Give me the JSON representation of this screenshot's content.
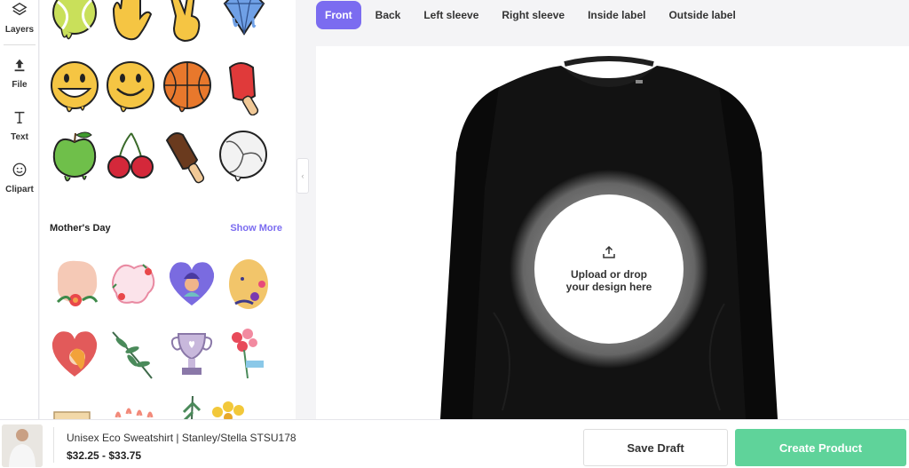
{
  "rail": {
    "items": [
      {
        "label": "Layers",
        "icon": "layers-icon"
      },
      {
        "label": "File",
        "icon": "upload-icon"
      },
      {
        "label": "Text",
        "icon": "text-icon"
      },
      {
        "label": "Clipart",
        "icon": "smiley-icon"
      }
    ]
  },
  "clipart": {
    "section_title": "Mother's Day",
    "show_more": "Show More"
  },
  "tabs": [
    {
      "label": "Front",
      "active": true
    },
    {
      "label": "Back"
    },
    {
      "label": "Left sleeve"
    },
    {
      "label": "Right sleeve"
    },
    {
      "label": "Inside label"
    },
    {
      "label": "Outside label"
    }
  ],
  "canvas": {
    "upload_line1": "Upload or drop",
    "upload_line2": "your design here"
  },
  "product": {
    "name": "Unisex Eco Sweatshirt | Stanley/Stella STSU178",
    "price": "$32.25 - $33.75"
  },
  "actions": {
    "save_draft": "Save Draft",
    "create_product": "Create Product"
  },
  "colors": {
    "accent": "#7b6cf0",
    "create": "#5fd39a",
    "garment": "#111111"
  }
}
